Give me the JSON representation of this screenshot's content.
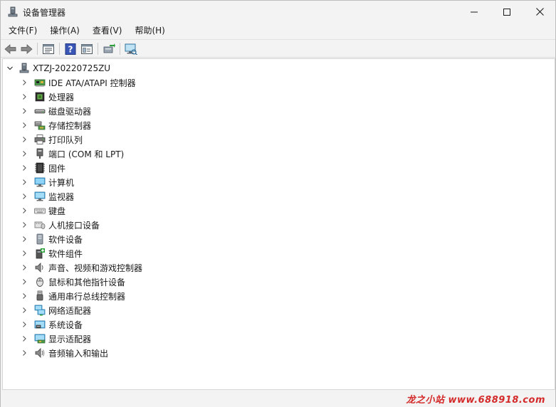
{
  "window": {
    "title": "设备管理器",
    "app_icon": "device-manager-icon"
  },
  "menu": {
    "items": [
      {
        "label": "文件(F)"
      },
      {
        "label": "操作(A)"
      },
      {
        "label": "查看(V)"
      },
      {
        "label": "帮助(H)"
      }
    ]
  },
  "toolbar": {
    "buttons": [
      "back-arrow-icon",
      "forward-arrow-icon",
      "properties-icon",
      "help-icon",
      "view-icon",
      "update-driver-icon",
      "scan-hardware-icon"
    ]
  },
  "tree": {
    "root": {
      "label": "XTZJ-20220725ZU",
      "icon": "computer-node-icon",
      "expanded": true
    },
    "items": [
      {
        "label": "IDE ATA/ATAPI 控制器",
        "icon": "ide-controller-icon"
      },
      {
        "label": "处理器",
        "icon": "processor-icon"
      },
      {
        "label": "磁盘驱动器",
        "icon": "disk-drive-icon"
      },
      {
        "label": "存储控制器",
        "icon": "storage-controller-icon"
      },
      {
        "label": "打印队列",
        "icon": "printer-icon"
      },
      {
        "label": "端口 (COM 和 LPT)",
        "icon": "port-icon"
      },
      {
        "label": "固件",
        "icon": "firmware-icon"
      },
      {
        "label": "计算机",
        "icon": "computer-icon"
      },
      {
        "label": "监视器",
        "icon": "monitor-icon"
      },
      {
        "label": "键盘",
        "icon": "keyboard-icon"
      },
      {
        "label": "人机接口设备",
        "icon": "hid-icon"
      },
      {
        "label": "软件设备",
        "icon": "software-device-icon"
      },
      {
        "label": "软件组件",
        "icon": "software-component-icon"
      },
      {
        "label": "声音、视频和游戏控制器",
        "icon": "sound-icon"
      },
      {
        "label": "鼠标和其他指针设备",
        "icon": "mouse-icon"
      },
      {
        "label": "通用串行总线控制器",
        "icon": "usb-icon"
      },
      {
        "label": "网络适配器",
        "icon": "network-adapter-icon"
      },
      {
        "label": "系统设备",
        "icon": "system-device-icon"
      },
      {
        "label": "显示适配器",
        "icon": "display-adapter-icon"
      },
      {
        "label": "音频输入和输出",
        "icon": "audio-io-icon"
      }
    ]
  },
  "statusbar": {
    "watermark": "龙之小站 www.688918.com"
  },
  "colors": {
    "window_bg": "#f3f3f3",
    "tree_bg": "#ffffff",
    "watermark": "#d42a2a"
  }
}
